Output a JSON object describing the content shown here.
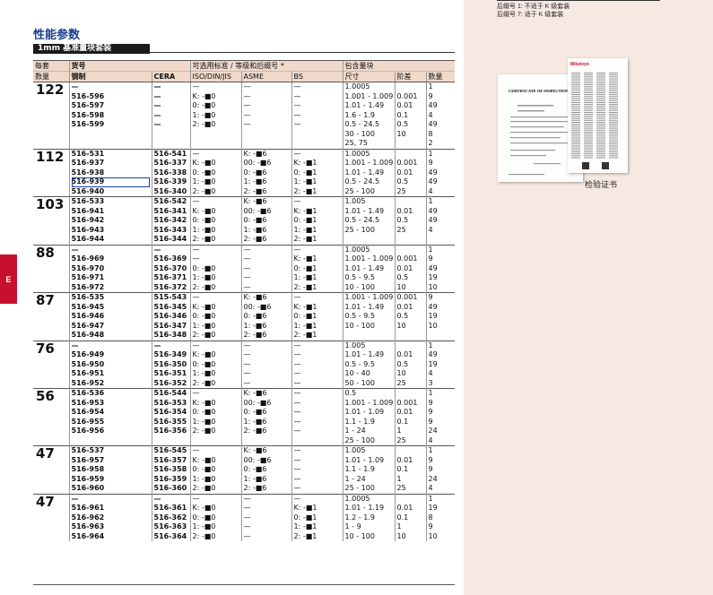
{
  "section_tab": "E",
  "title": "性能参数",
  "subtitle": "1mm 基准量块套装",
  "sidebar_notes": [
    "后缀号 1:  不适于 K 级套装",
    "后缀号 7:  适于 K 级套装"
  ],
  "certificate": {
    "brand": "Mitutoyo",
    "heading": "CERTIFICATE OF INSPECTION",
    "caption": "检验证书"
  },
  "table": {
    "header1": {
      "qty": "每套",
      "order": "货号",
      "standards": "可选用标准 / 等级和后缀号 *",
      "contents": "包含量块"
    },
    "header2": {
      "qty": "数量",
      "steel": "钢制",
      "cera": "CERA",
      "iso": "ISO/DIN/JIS",
      "asme": "ASME",
      "bs": "BS",
      "size": "尺寸",
      "step": "阶差",
      "count": "数量"
    },
    "groups": [
      {
        "qty": "122",
        "steel": [
          "—",
          "516-596",
          "516-597",
          "516-598",
          "516-599"
        ],
        "cera": [
          "—",
          "—",
          "—",
          "—",
          "—"
        ],
        "iso": [
          "—",
          "K: -■0",
          "0: -■0",
          "1: -■0",
          "2: -■0"
        ],
        "asme": [
          "—",
          "—",
          "—",
          "—",
          "—"
        ],
        "bs": [
          "—",
          "—",
          "—",
          "—",
          "—"
        ],
        "size": [
          "1.0005",
          "1.001 - 1.009",
          "1.01 - 1.49",
          "1.6 - 1.9",
          "0.5 - 24.5",
          "30 - 100",
          "25, 75"
        ],
        "step": [
          "",
          "0.001",
          "0.01",
          "0.1",
          "0.5",
          "10",
          ""
        ],
        "count": [
          "1",
          "9",
          "49",
          "4",
          "49",
          "8",
          "2"
        ]
      },
      {
        "qty": "112",
        "steel": [
          "516-531",
          "516-937",
          "516-938",
          "516-939",
          "516-940"
        ],
        "cera": [
          "516-541",
          "516-337",
          "516-338",
          "516-339",
          "516-340"
        ],
        "iso": [
          "—",
          "K: -■0",
          "0: -■0",
          "1: -■0",
          "2: -■0"
        ],
        "asme": [
          "K: -■6",
          "00: -■6",
          "0: -■6",
          "1: -■6",
          "2: -■6"
        ],
        "bs": [
          "—",
          "K: -■1",
          "0: -■1",
          "1: -■1",
          "2: -■1"
        ],
        "size": [
          "1.0005",
          "1.001 - 1.009",
          "1.01 - 1.49",
          "0.5 - 24.5",
          "25 - 100"
        ],
        "step": [
          "",
          "0.001",
          "0.01",
          "0.5",
          "25"
        ],
        "count": [
          "1",
          "9",
          "49",
          "49",
          "4"
        ]
      },
      {
        "qty": "103",
        "steel": [
          "516-533",
          "516-941",
          "516-942",
          "516-943",
          "516-944"
        ],
        "cera": [
          "516-542",
          "516-341",
          "516-342",
          "516-343",
          "516-344"
        ],
        "iso": [
          "—",
          "K: -■0",
          "0: -■0",
          "1: -■0",
          "2: -■0"
        ],
        "asme": [
          "K: -■6",
          "00: -■6",
          "0: -■6",
          "1: -■6",
          "2: -■6"
        ],
        "bs": [
          "—",
          "K: -■1",
          "0: -■1",
          "1: -■1",
          "2: -■1"
        ],
        "size": [
          "1.005",
          "1.01 - 1.49",
          "0.5 - 24.5",
          "25 - 100"
        ],
        "step": [
          "",
          "0.01",
          "0.5",
          "25"
        ],
        "count": [
          "1",
          "49",
          "49",
          "4"
        ]
      },
      {
        "qty": "88",
        "steel": [
          "—",
          "516-969",
          "516-970",
          "516-971",
          "516-972"
        ],
        "cera": [
          "—",
          "516-369",
          "516-370",
          "516-371",
          "516-372"
        ],
        "iso": [
          "—",
          "—",
          "0: -■0",
          "1: -■0",
          "2: -■0"
        ],
        "asme": [
          "—",
          "—",
          "—",
          "—",
          "—"
        ],
        "bs": [
          "—",
          "K: -■1",
          "0: -■1",
          "1: -■1",
          "2: -■1"
        ],
        "size": [
          "1.0005",
          "1.001 - 1.009",
          "1.01 - 1.49",
          "0.5 - 9.5",
          "10 - 100"
        ],
        "step": [
          "",
          "0.001",
          "0.01",
          "0.5",
          "10"
        ],
        "count": [
          "1",
          "9",
          "49",
          "19",
          "10"
        ]
      },
      {
        "qty": "87",
        "steel": [
          "516-535",
          "516-945",
          "516-946",
          "516-947",
          "516-948"
        ],
        "cera": [
          "515-543",
          "516-345",
          "516-346",
          "516-347",
          "516-348"
        ],
        "iso": [
          "—",
          "K: -■0",
          "0: -■0",
          "1: -■0",
          "2: -■0"
        ],
        "asme": [
          "K: -■6",
          "00: -■6",
          "0: -■6",
          "1: -■6",
          "2: -■6"
        ],
        "bs": [
          "—",
          "K: -■1",
          "0: -■1",
          "1: -■1",
          "2: -■1"
        ],
        "size": [
          "1.001 - 1.009",
          "1.01 - 1.49",
          "0.5 - 9.5",
          "10 - 100"
        ],
        "step": [
          "0.001",
          "0.01",
          "0.5",
          "10"
        ],
        "count": [
          "9",
          "49",
          "19",
          "10"
        ]
      },
      {
        "qty": "76",
        "steel": [
          "—",
          "516-949",
          "516-950",
          "516-951",
          "516-952"
        ],
        "cera": [
          "—",
          "516-349",
          "516-350",
          "516-351",
          "516-352"
        ],
        "iso": [
          "—",
          "K: -■0",
          "0: -■0",
          "1: -■0",
          "2: -■0"
        ],
        "asme": [
          "—",
          "—",
          "—",
          "—",
          "—"
        ],
        "bs": [
          "—",
          "—",
          "—",
          "—",
          "—"
        ],
        "size": [
          "1.005",
          "1.01 - 1.49",
          "0.5 - 9.5",
          "10 - 40",
          "50 - 100"
        ],
        "step": [
          "",
          "0.01",
          "0.5",
          "10",
          "25"
        ],
        "count": [
          "1",
          "49",
          "19",
          "4",
          "3"
        ]
      },
      {
        "qty": "56",
        "steel": [
          "516-536",
          "516-953",
          "516-954",
          "516-955",
          "516-956"
        ],
        "cera": [
          "516-544",
          "516-353",
          "516-354",
          "516-355",
          "516-356"
        ],
        "iso": [
          "—",
          "K: -■0",
          "0: -■0",
          "1: -■0",
          "2: -■0"
        ],
        "asme": [
          "K: -■6",
          "00: -■6",
          "0: -■6",
          "1: -■6",
          "2: -■6"
        ],
        "bs": [
          "—",
          "—",
          "—",
          "—",
          "—"
        ],
        "size": [
          "0.5",
          "1.001 - 1.009",
          "1.01 - 1.09",
          "1.1 - 1.9",
          "1 - 24",
          "25 - 100"
        ],
        "step": [
          "",
          "0.001",
          "0.01",
          "0.1",
          "1",
          "25"
        ],
        "count": [
          "1",
          "9",
          "9",
          "9",
          "24",
          "4"
        ]
      },
      {
        "qty": "47",
        "steel": [
          "516-537",
          "516-957",
          "516-958",
          "516-959",
          "516-960"
        ],
        "cera": [
          "516-545",
          "516-357",
          "516-358",
          "516-359",
          "516-360"
        ],
        "iso": [
          "—",
          "K: -■0",
          "0: -■0",
          "1: -■0",
          "2: -■0"
        ],
        "asme": [
          "K: -■6",
          "00: -■6",
          "0: -■6",
          "1: -■6",
          "2: -■6"
        ],
        "bs": [
          "—",
          "—",
          "—",
          "—",
          "—"
        ],
        "size": [
          "1.005",
          "1.01 - 1.09",
          "1.1 - 1.9",
          "1 - 24",
          "25 - 100"
        ],
        "step": [
          "",
          "0.01",
          "0.1",
          "1",
          "25"
        ],
        "count": [
          "1",
          "9",
          "9",
          "24",
          "4"
        ]
      },
      {
        "qty": "47",
        "steel": [
          "—",
          "516-961",
          "516-962",
          "516-963",
          "516-964"
        ],
        "cera": [
          "—",
          "516-361",
          "516-362",
          "516-363",
          "516-364"
        ],
        "iso": [
          "—",
          "K: -■0",
          "0: -■0",
          "1: -■0",
          "2: -■0"
        ],
        "asme": [
          "—",
          "—",
          "—",
          "—",
          "—"
        ],
        "bs": [
          "—",
          "K: -■1",
          "0: -■1",
          "1: -■1",
          "2: -■1"
        ],
        "size": [
          "1.0005",
          "1.01 - 1.19",
          "1.2 - 1.9",
          "1 - 9",
          "10 - 100"
        ],
        "step": [
          "",
          "0.01",
          "0.1",
          "1",
          "10"
        ],
        "count": [
          "1",
          "19",
          "8",
          "9",
          "10"
        ]
      }
    ]
  }
}
